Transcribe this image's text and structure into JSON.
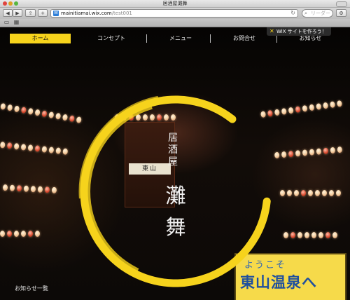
{
  "window": {
    "title": "居酒屋灘舞"
  },
  "toolbar": {
    "url_host": "mainitiamai.wix.com",
    "url_path": "/test001",
    "search_placeholder": "リーダー"
  },
  "nav": {
    "items": [
      {
        "label": "ホーム",
        "active": true
      },
      {
        "label": "コンセプト"
      },
      {
        "label": "メニュー"
      },
      {
        "label": "お問合せ"
      },
      {
        "label": "お知らせ"
      }
    ]
  },
  "wix_badge": {
    "label": "WiX サイトを作ろう！"
  },
  "logo": {
    "subtitle": "居酒屋",
    "name": "灘舞",
    "ring_color": "#f6d31c"
  },
  "background": {
    "shrine_sign": "東山",
    "billboard_top": "ようこそ",
    "billboard_main": "東山温泉へ"
  },
  "footer": {
    "news_link": "お知らせ一覧"
  },
  "colors": {
    "accent": "#f6d31c"
  }
}
